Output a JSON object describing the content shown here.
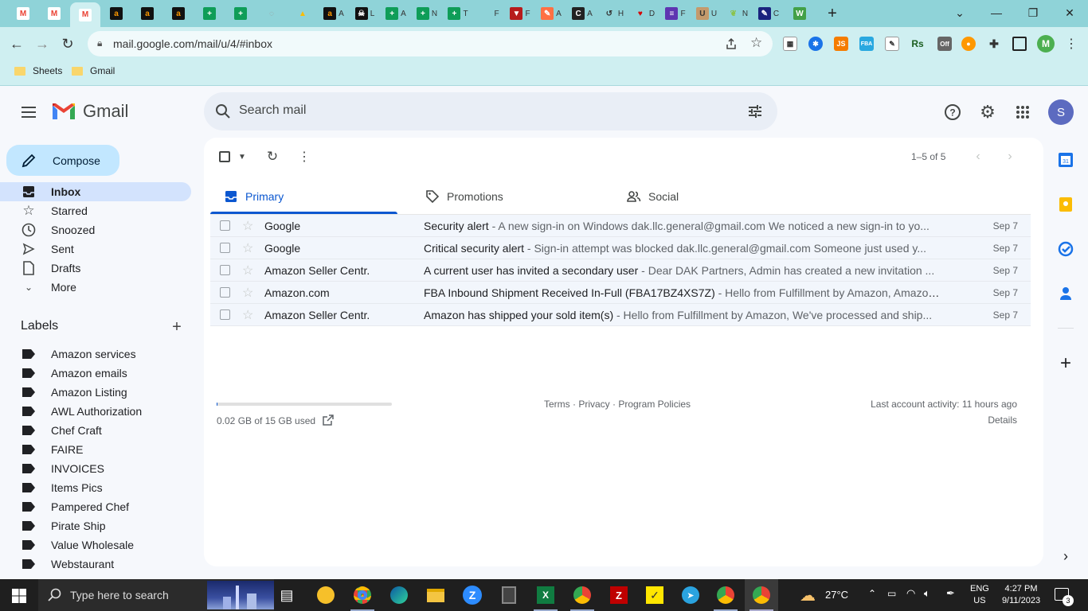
{
  "browser": {
    "tabs": [
      {
        "icon": "gmail-icon",
        "label": ""
      },
      {
        "icon": "gmail-icon",
        "label": ""
      },
      {
        "icon": "gmail-icon",
        "label": "",
        "active": true
      },
      {
        "icon": "amazon-icon",
        "label": ""
      },
      {
        "icon": "amazon-icon",
        "label": ""
      },
      {
        "icon": "amazon-icon",
        "label": ""
      },
      {
        "icon": "sheets-icon",
        "label": ""
      },
      {
        "icon": "sheets-icon",
        "label": ""
      },
      {
        "icon": "loading-icon",
        "label": ""
      },
      {
        "icon": "drive-icon",
        "label": ""
      },
      {
        "icon": "amazon-icon",
        "label": "A"
      },
      {
        "icon": "pirate-icon",
        "label": "L"
      },
      {
        "icon": "sheets-icon",
        "label": "A"
      },
      {
        "icon": "sheets-icon",
        "label": "N"
      },
      {
        "icon": "sheets-icon",
        "label": "T"
      },
      {
        "icon": "blank-icon",
        "label": "F"
      },
      {
        "icon": "shield-icon",
        "label": "F"
      },
      {
        "icon": "pen-icon",
        "label": "A"
      },
      {
        "icon": "c-icon",
        "label": "A"
      },
      {
        "icon": "history-icon",
        "label": "H"
      },
      {
        "icon": "heart-icon",
        "label": "D"
      },
      {
        "icon": "form-icon",
        "label": "F"
      },
      {
        "icon": "uline-icon",
        "label": "U"
      },
      {
        "icon": "leaf-icon",
        "label": "N"
      },
      {
        "icon": "edit-icon",
        "label": "C"
      },
      {
        "icon": "w-icon",
        "label": ""
      }
    ],
    "url": "mail.google.com/mail/u/4/#inbox",
    "bookmarks": [
      "Sheets",
      "Gmail"
    ],
    "profile_initial": "M"
  },
  "gmail": {
    "logo_text": "Gmail",
    "search_placeholder": "Search mail",
    "avatar_initial": "S",
    "compose_label": "Compose",
    "nav": [
      {
        "label": "Inbox",
        "icon": "inbox-icon",
        "active": true
      },
      {
        "label": "Starred",
        "icon": "star-icon"
      },
      {
        "label": "Snoozed",
        "icon": "clock-icon"
      },
      {
        "label": "Sent",
        "icon": "send-icon"
      },
      {
        "label": "Drafts",
        "icon": "draft-icon"
      },
      {
        "label": "More",
        "icon": "chevron-down-icon"
      }
    ],
    "labels_title": "Labels",
    "labels": [
      "Amazon services",
      "Amazon emails",
      "Amazon Listing",
      "AWL Authorization",
      "Chef Craft",
      "FAIRE",
      "INVOICES",
      "Items Pics",
      "Pampered Chef",
      "Pirate Ship",
      "Value Wholesale",
      "Webstaurant"
    ],
    "pager_text": "1–5 of 5",
    "tabs": [
      {
        "label": "Primary",
        "icon": "inbox-icon",
        "active": true
      },
      {
        "label": "Promotions",
        "icon": "tag-icon"
      },
      {
        "label": "Social",
        "icon": "people-icon"
      }
    ],
    "emails": [
      {
        "sender": "Google",
        "subject": "Security alert",
        "snippet": " - A new sign-in on Windows dak.llc.general@gmail.com We noticed a new sign-in to yo...",
        "date": "Sep 7"
      },
      {
        "sender": "Google",
        "subject": "Critical security alert",
        "snippet": " - Sign-in attempt was blocked dak.llc.general@gmail.com Someone just used y...",
        "date": "Sep 7"
      },
      {
        "sender": "Amazon Seller Centr.",
        "subject": "A current user has invited a secondary user",
        "snippet": " - Dear DAK Partners, Admin has created a new invitation ...",
        "date": "Sep 7"
      },
      {
        "sender": "Amazon.com",
        "subject": "FBA Inbound Shipment Received In-Full (FBA17BZ4XS7Z)",
        "snippet": " - Hello from Fulfillment by Amazon, Amazon ...",
        "date": "Sep 7"
      },
      {
        "sender": "Amazon Seller Centr.",
        "subject": "Amazon has shipped your sold item(s)",
        "snippet": " - Hello from Fulfillment by Amazon, We've processed and ship...",
        "date": "Sep 7"
      }
    ],
    "storage_text": "0.02 GB of 15 GB used",
    "storage_fraction": 0.0013,
    "footer_links": "Terms · Privacy · Program Policies",
    "last_activity": "Last account activity: 11 hours ago",
    "details_label": "Details"
  },
  "taskbar": {
    "search_placeholder": "Type here to search",
    "temperature": "27°C",
    "lang_top": "ENG",
    "lang_bottom": "US",
    "time": "4:27 PM",
    "date": "9/11/2023",
    "notification_count": "3"
  },
  "colors": {
    "tab_strip": "#8fd3d8",
    "toolbar": "#cfeff1",
    "accent": "#0b57d0",
    "compose_bg": "#c2e7ff",
    "nav_active": "#d3e3fd"
  }
}
